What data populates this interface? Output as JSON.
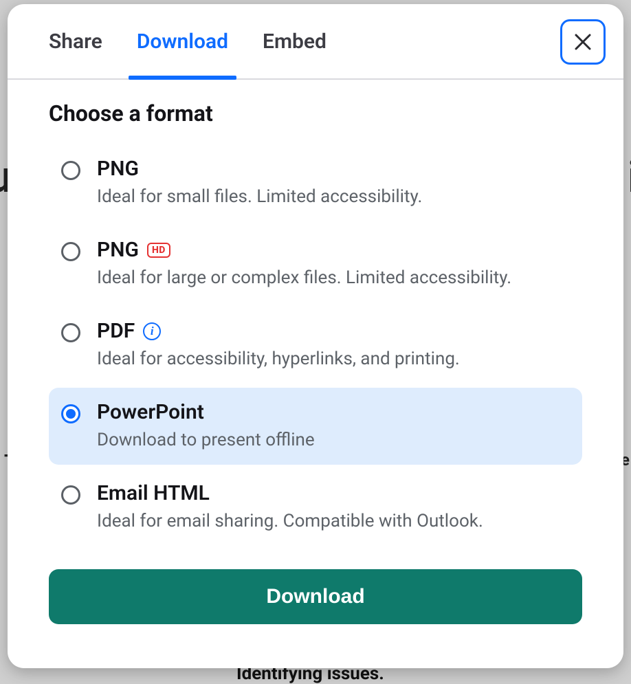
{
  "tabs": {
    "share": "Share",
    "download": "Download",
    "embed": "Embed",
    "active": "download"
  },
  "heading": "Choose a format",
  "options": [
    {
      "id": "png",
      "title": "PNG",
      "desc": "Ideal for small files. Limited accessibility.",
      "badge": null,
      "selected": false
    },
    {
      "id": "png-hd",
      "title": "PNG",
      "desc": "Ideal for large or complex files. Limited accessibility.",
      "badge": "HD",
      "selected": false
    },
    {
      "id": "pdf",
      "title": "PDF",
      "desc": "Ideal for accessibility, hyperlinks, and printing.",
      "badge": "info",
      "selected": false
    },
    {
      "id": "powerpoint",
      "title": "PowerPoint",
      "desc": "Download to present offline",
      "badge": null,
      "selected": true
    },
    {
      "id": "email-html",
      "title": "Email HTML",
      "desc": "Ideal for email sharing. Compatible with Outlook.",
      "badge": null,
      "selected": false
    }
  ],
  "actions": {
    "download": "Download"
  },
  "badges": {
    "hd": "HD",
    "info": "i"
  },
  "backdrop": {
    "b1": "u",
    "b2": "i",
    "b3": "T",
    "b4": "e",
    "b5": "Identifying issues."
  }
}
